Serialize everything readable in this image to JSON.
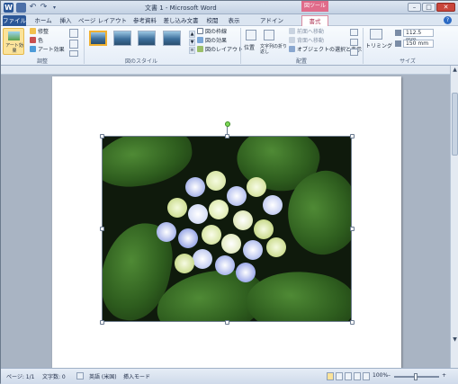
{
  "title_bar": {
    "logo": "W",
    "title": "文書 1 - Microsoft Word",
    "tool_context": "図ツール",
    "undo_icon": "↶",
    "redo_icon": "↷",
    "dropdown_icon": "▾",
    "min_icon": "–",
    "max_icon": "□",
    "close_icon": "✕"
  },
  "tabs": {
    "file": "ファイル",
    "home": "ホーム",
    "insert": "挿入",
    "page_layout": "ページ レイアウト",
    "references": "参考資料",
    "mailings": "差し込み文書",
    "review": "校閲",
    "view": "表示",
    "addins": "アドイン",
    "format": "書式",
    "help_icon": "?"
  },
  "ribbon": {
    "adjust": {
      "artistic_label": "アート効果",
      "corrections": "修整",
      "color": "色",
      "artistic_effects": "アート効果",
      "group_label": "調整"
    },
    "styles": {
      "group_label": "図のスタイル",
      "border": "図の枠線",
      "effects": "図の効果",
      "layout": "図のレイアウト"
    },
    "arrange": {
      "position": "位置",
      "wrap": "文字列の折り返し",
      "bring_forward": "前面へ移動",
      "send_backward": "背面へ移動",
      "selection_pane": "オブジェクトの選択と表示",
      "group_label": "配置"
    },
    "size": {
      "crop": "トリミング",
      "height": "112.5 mm",
      "width": "150 mm",
      "group_label": "サイズ"
    }
  },
  "status_bar": {
    "page": "ページ: 1/1",
    "words": "文字数: 0",
    "language": "英語 (米国)",
    "mode": "挿入モード",
    "zoom": "100%",
    "zoom_minus": "–",
    "zoom_plus": "+"
  },
  "colors": {
    "file_tab": "#2b5797",
    "format_tab_accent": "#d98aa0",
    "close_button": "#c9453b",
    "picture_background": "#0f1a0c"
  }
}
